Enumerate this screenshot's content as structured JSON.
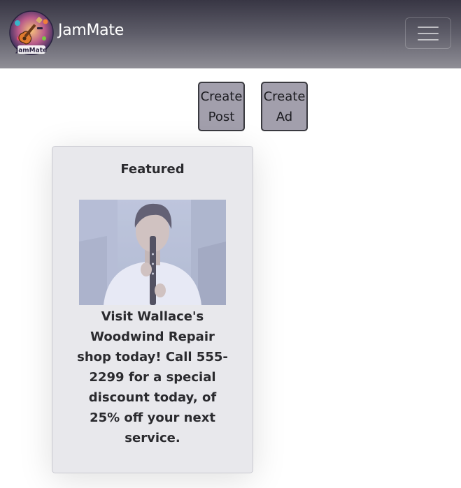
{
  "navbar": {
    "brand_name": "JamMate",
    "logo_text": "JamMate",
    "logo_icon": "guitar-logo-icon",
    "menu_icon": "hamburger-menu-icon"
  },
  "actions": {
    "create_post_label": "Create\nPost",
    "create_ad_label": "Create\nAd"
  },
  "featured": {
    "title": "Featured",
    "image_subject": "clarinet-player-photo",
    "ad_text": "Visit Wallace's Woodwind Repair shop today! Call 555-2299 for a special discount today, of 25% off your next service."
  },
  "colors": {
    "navbar_top": "#383644",
    "navbar_bottom": "#8f8e96",
    "button_bg": "#a29fac",
    "card_bg": "#e8e8ec"
  }
}
